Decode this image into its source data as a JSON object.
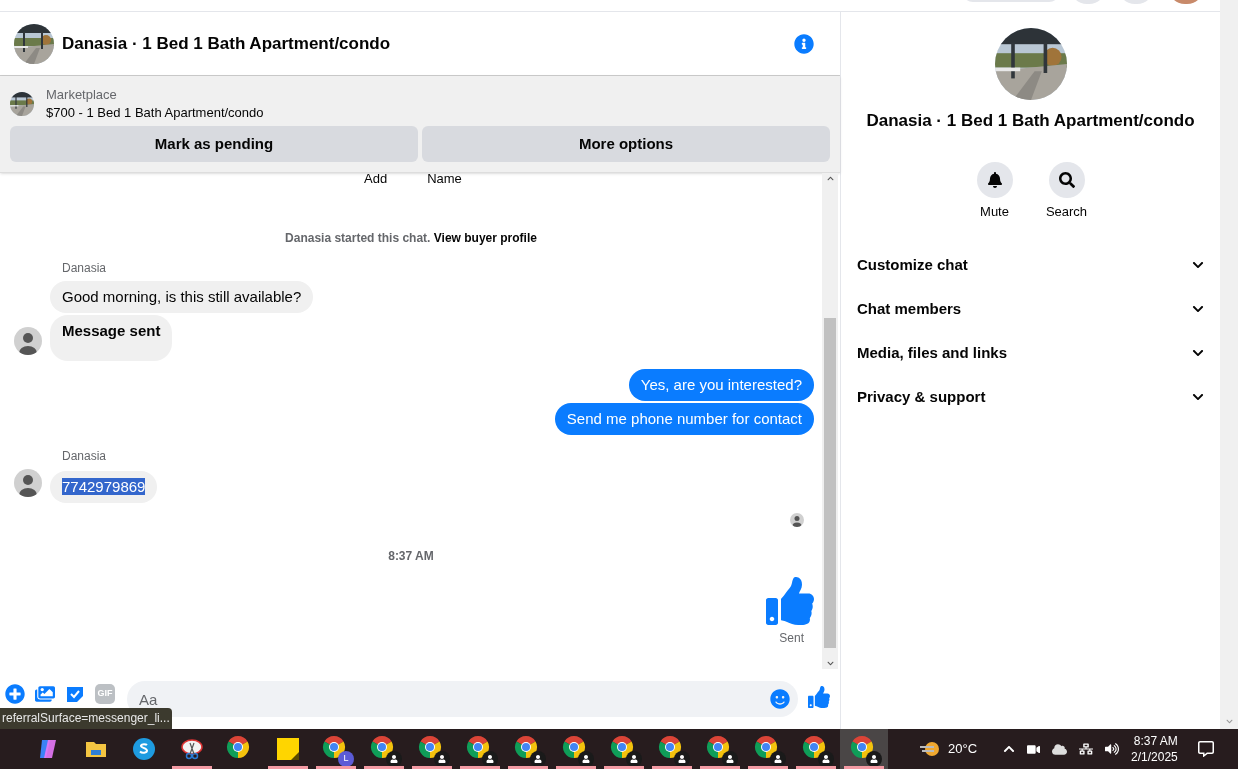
{
  "header": {
    "title": "Danasia · 1 Bed 1 Bath Apartment/condo"
  },
  "listing": {
    "source": "Marketplace",
    "title": "$700 - 1 Bed 1 Bath Apartment/condo",
    "actions": [
      "Mark as pending",
      "More options"
    ]
  },
  "partial_labels": [
    "Add",
    "Name"
  ],
  "messages": [
    {
      "kind": "system",
      "text": "Danasia started this chat.",
      "link": "View buyer profile"
    },
    {
      "kind": "incoming",
      "sender": "Danasia",
      "bubbles": [
        {
          "text": "Good morning, is this still available?",
          "bold": false,
          "highlighted": false
        },
        {
          "text": "Message sent",
          "bold": true,
          "highlighted": false
        }
      ]
    },
    {
      "kind": "outgoing",
      "bubbles": [
        {
          "text": "Yes, are you interested?"
        },
        {
          "text": "Send me phone number for contact"
        }
      ]
    },
    {
      "kind": "incoming",
      "sender": "Danasia",
      "bubbles": [
        {
          "text": "7742979869",
          "bold": false,
          "highlighted": true
        }
      ]
    },
    {
      "kind": "seen"
    },
    {
      "kind": "timestamp",
      "text": "8:37 AM"
    },
    {
      "kind": "like",
      "status": "Sent"
    }
  ],
  "composer": {
    "placeholder": "Aa",
    "gif_label": "GIF"
  },
  "tooltip": "referralSurface=messenger_li...",
  "details": {
    "title": "Danasia · 1 Bed 1 Bath Apartment/condo",
    "actions": [
      {
        "kind": "mute",
        "label": "Mute"
      },
      {
        "kind": "search",
        "label": "Search"
      }
    ],
    "sections": [
      {
        "label": "Customize chat",
        "expanded": false
      },
      {
        "label": "Chat members",
        "expanded": false
      },
      {
        "label": "Media, files and links",
        "expanded": false
      },
      {
        "label": "Privacy & support",
        "expanded": false
      }
    ]
  },
  "taskbar": {
    "apps": [
      {
        "kind": "copilot",
        "running": false,
        "selected": false
      },
      {
        "kind": "folder",
        "running": false,
        "selected": false
      },
      {
        "kind": "skype",
        "running": false,
        "selected": false
      },
      {
        "kind": "snip",
        "running": true,
        "selected": false
      },
      {
        "kind": "chrome",
        "running": false,
        "selected": false
      },
      {
        "kind": "sticky",
        "running": true,
        "selected": false
      },
      {
        "kind": "chrome",
        "badge": "L",
        "running": true,
        "selected": false
      },
      {
        "kind": "chrome-profile",
        "running": true,
        "selected": false
      },
      {
        "kind": "chrome-profile",
        "running": true,
        "selected": false
      },
      {
        "kind": "chrome-profile",
        "running": true,
        "selected": false
      },
      {
        "kind": "chrome-profile",
        "running": true,
        "selected": false
      },
      {
        "kind": "chrome-profile",
        "running": true,
        "selected": false
      },
      {
        "kind": "chrome-profile",
        "running": true,
        "selected": false
      },
      {
        "kind": "chrome-profile",
        "running": true,
        "selected": false
      },
      {
        "kind": "chrome-profile",
        "running": true,
        "selected": false
      },
      {
        "kind": "chrome-profile",
        "running": true,
        "selected": false
      },
      {
        "kind": "chrome-profile",
        "running": true,
        "selected": false
      },
      {
        "kind": "chrome-profile",
        "running": true,
        "selected": true
      }
    ],
    "temperature": "20°C",
    "time": "8:37 AM",
    "date": "2/1/2025"
  }
}
